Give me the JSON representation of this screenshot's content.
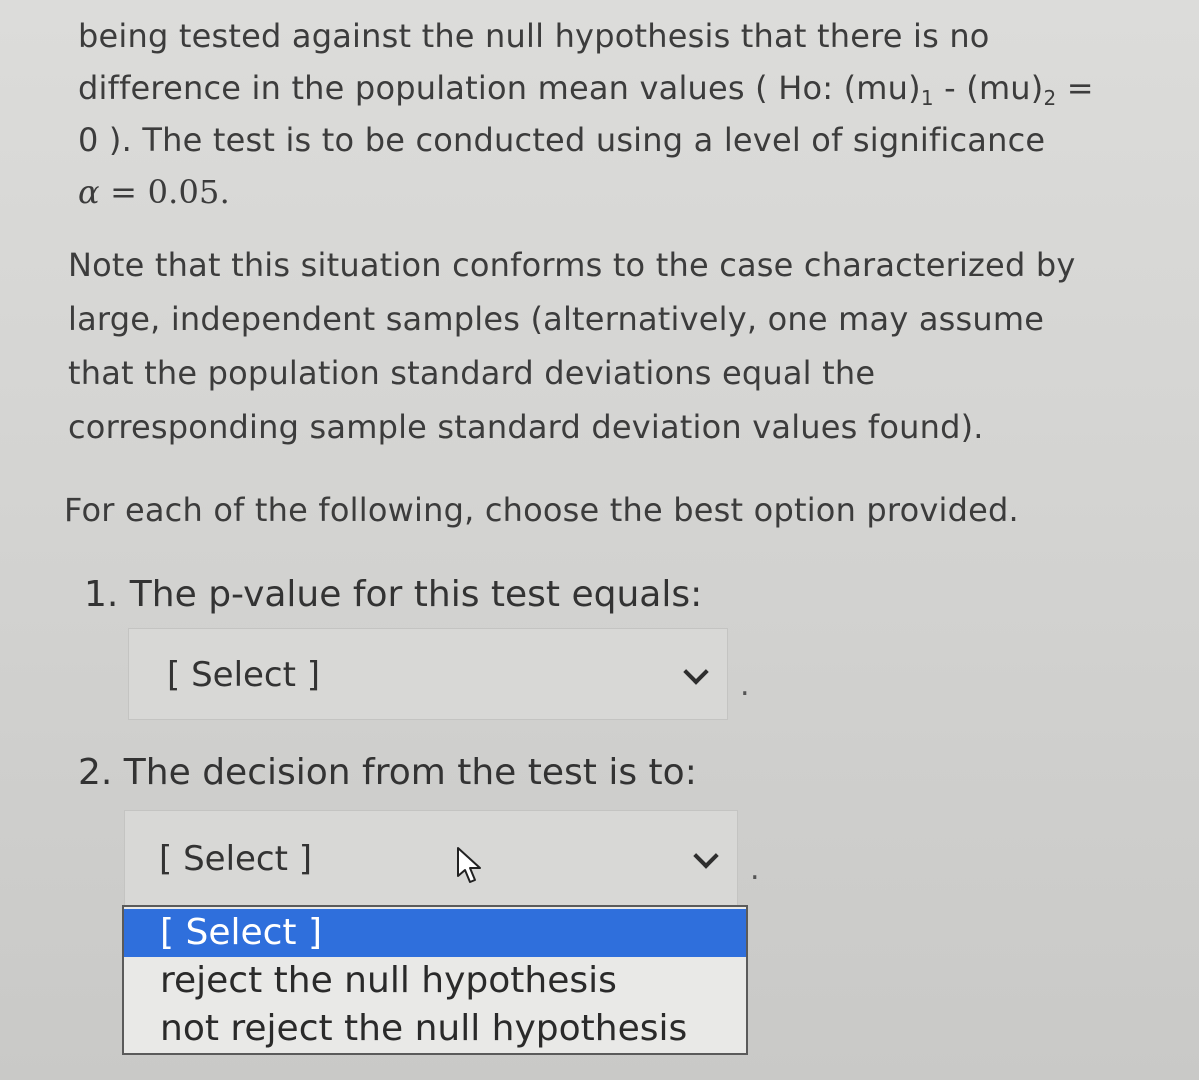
{
  "intro": {
    "line1": "being tested against the null hypothesis that there is no",
    "line2": "difference in the population mean values ( Ho: (mu)",
    "line2_sub1": "1",
    "line2_mid": " - (mu)",
    "line2_sub2": "2",
    "line2_end": " =",
    "line3": "0 ).  The test is to be conducted using a level of significance",
    "alpha_symbol": "α",
    "alpha_value": " = 0.05."
  },
  "note": {
    "line1": "Note that this situation conforms to the case characterized by",
    "line2": "large, independent samples (alternatively, one may assume",
    "line3": "that the population standard deviations equal the",
    "line4": "corresponding sample standard deviation values found)."
  },
  "instruction": "For each of the following, choose the best option provided.",
  "questions": [
    {
      "label": "1. The p-value for this test equals:",
      "selected": "[ Select ]",
      "trail": "."
    },
    {
      "label": "2. The decision from the test is to:",
      "selected": "[ Select ]",
      "trail": "."
    }
  ],
  "dropdown": {
    "options": [
      "[ Select ]",
      "reject the null hypothesis",
      "not reject the null hypothesis"
    ],
    "highlighted_index": 0,
    "highlight_color": "#2f6fdc"
  },
  "icons": {
    "select_arrow": "chevron-down-icon",
    "cursor": "mouse-pointer-icon"
  }
}
